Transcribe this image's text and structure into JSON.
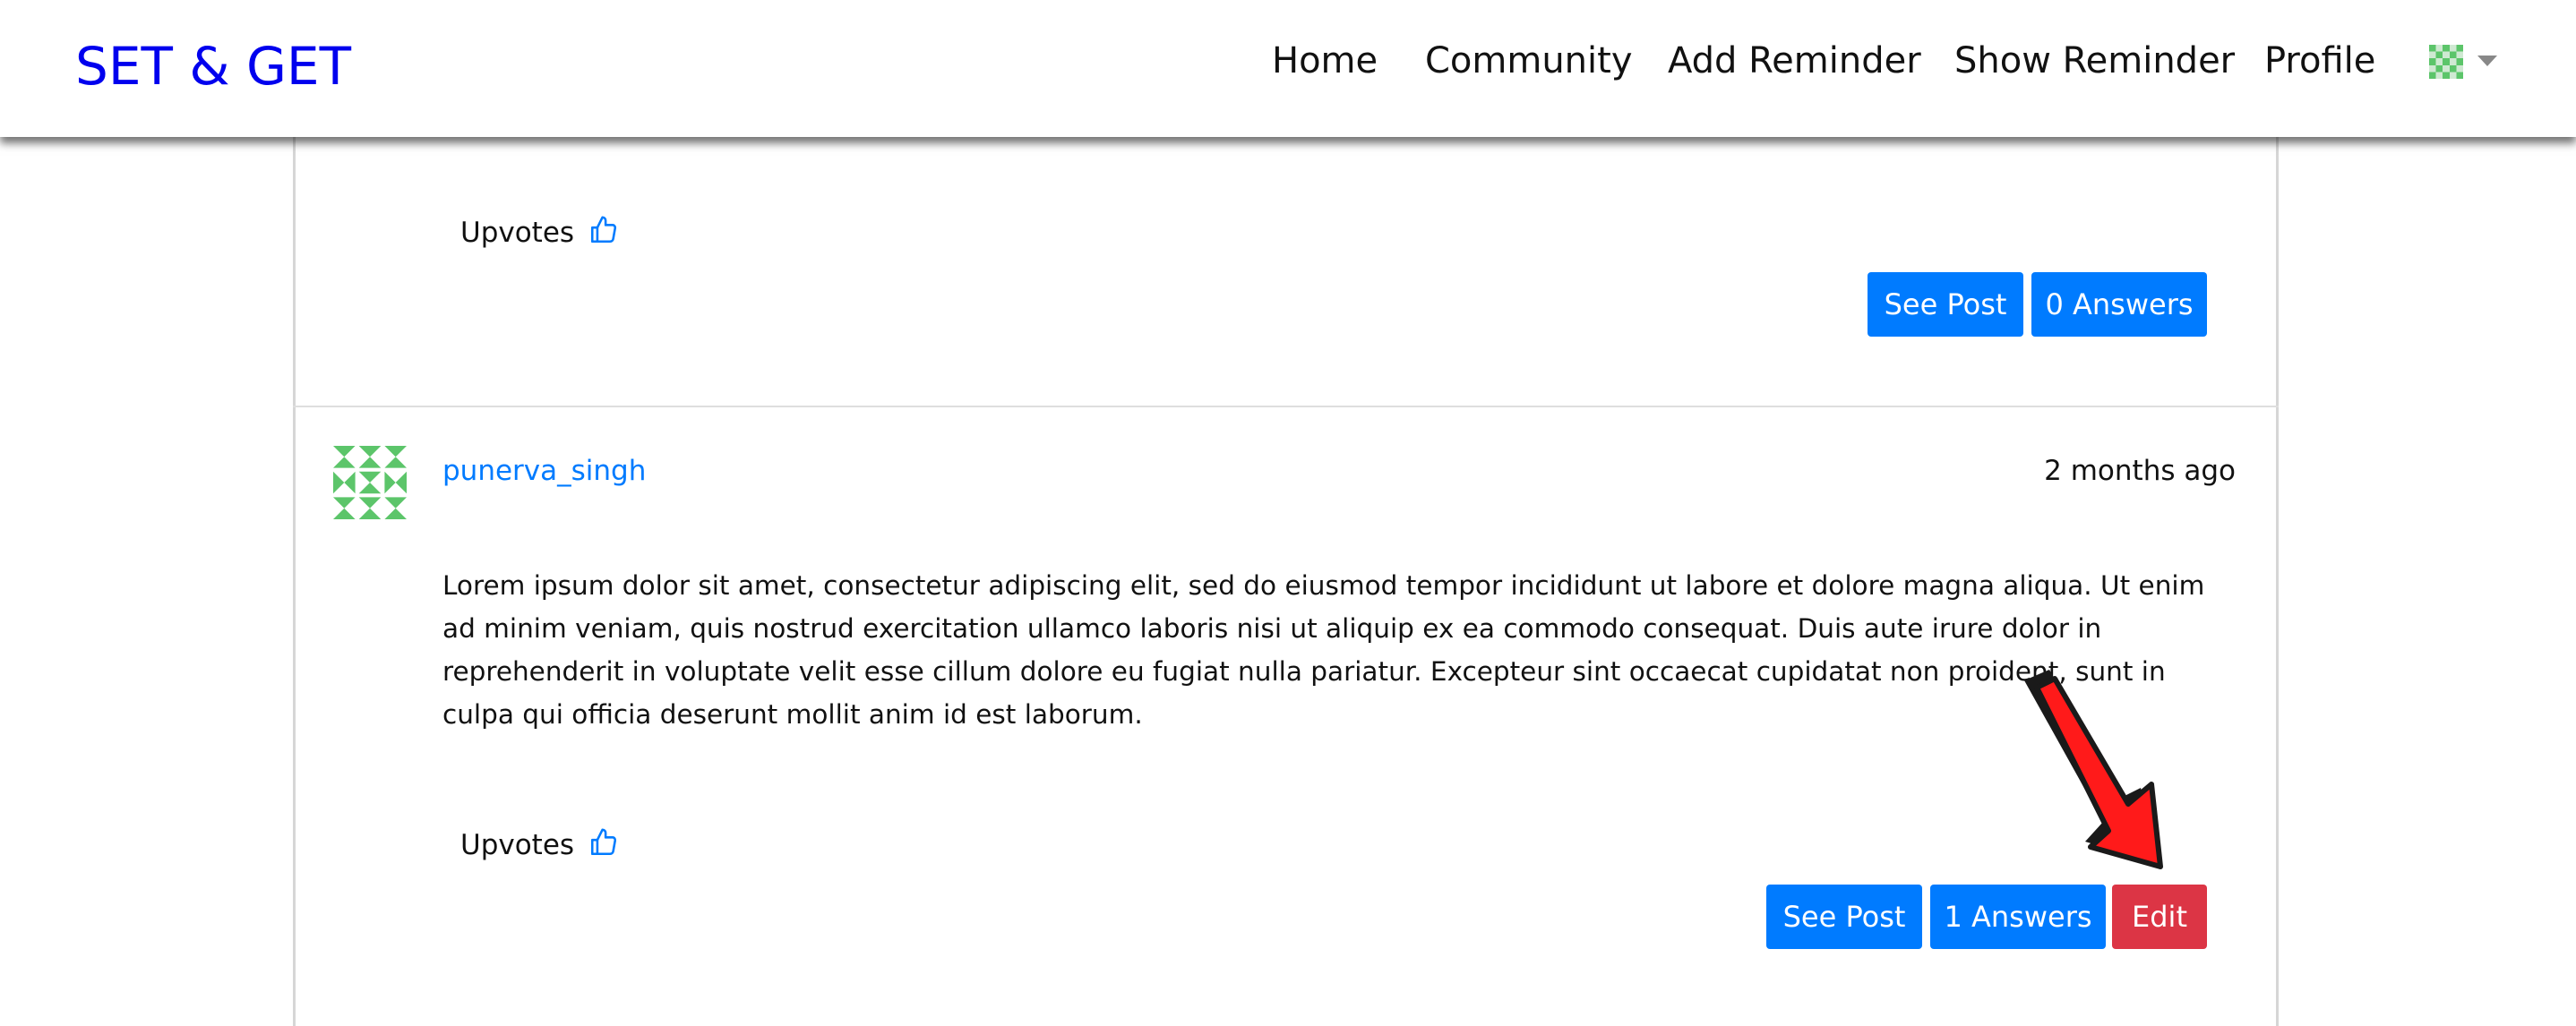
{
  "navbar": {
    "brand": "SET & GET",
    "links": [
      "Home",
      "Community",
      "Add Reminder",
      "Show Reminder",
      "Profile"
    ],
    "avatar_icon": "identicon-avatar-icon",
    "dropdown_icon": "caret-down-icon"
  },
  "posts": [
    {
      "upvotes_label": "Upvotes",
      "see_post_label": "See Post",
      "answers_label": "0 Answers"
    },
    {
      "author": "punerva_singh",
      "time": "2 months ago",
      "body": "Lorem ipsum dolor sit amet, consectetur adipiscing elit, sed do eiusmod tempor incididunt ut labore et dolore magna aliqua. Ut enim ad minim veniam, quis nostrud exercitation ullamco laboris nisi ut aliquip ex ea commodo consequat. Duis aute irure dolor in reprehenderit in voluptate velit esse cillum dolore eu fugiat nulla pariatur. Excepteur sint occaecat cupidatat non proident, sunt in culpa qui officia deserunt mollit anim id est laborum.",
      "upvotes_label": "Upvotes",
      "see_post_label": "See Post",
      "answers_label": "1 Answers",
      "edit_label": "Edit"
    }
  ],
  "colors": {
    "brand": "#0000ee",
    "primary": "#007bff",
    "danger": "#dc3545",
    "arrow": "#ff1a1a",
    "identicon": "#5cc56a"
  }
}
